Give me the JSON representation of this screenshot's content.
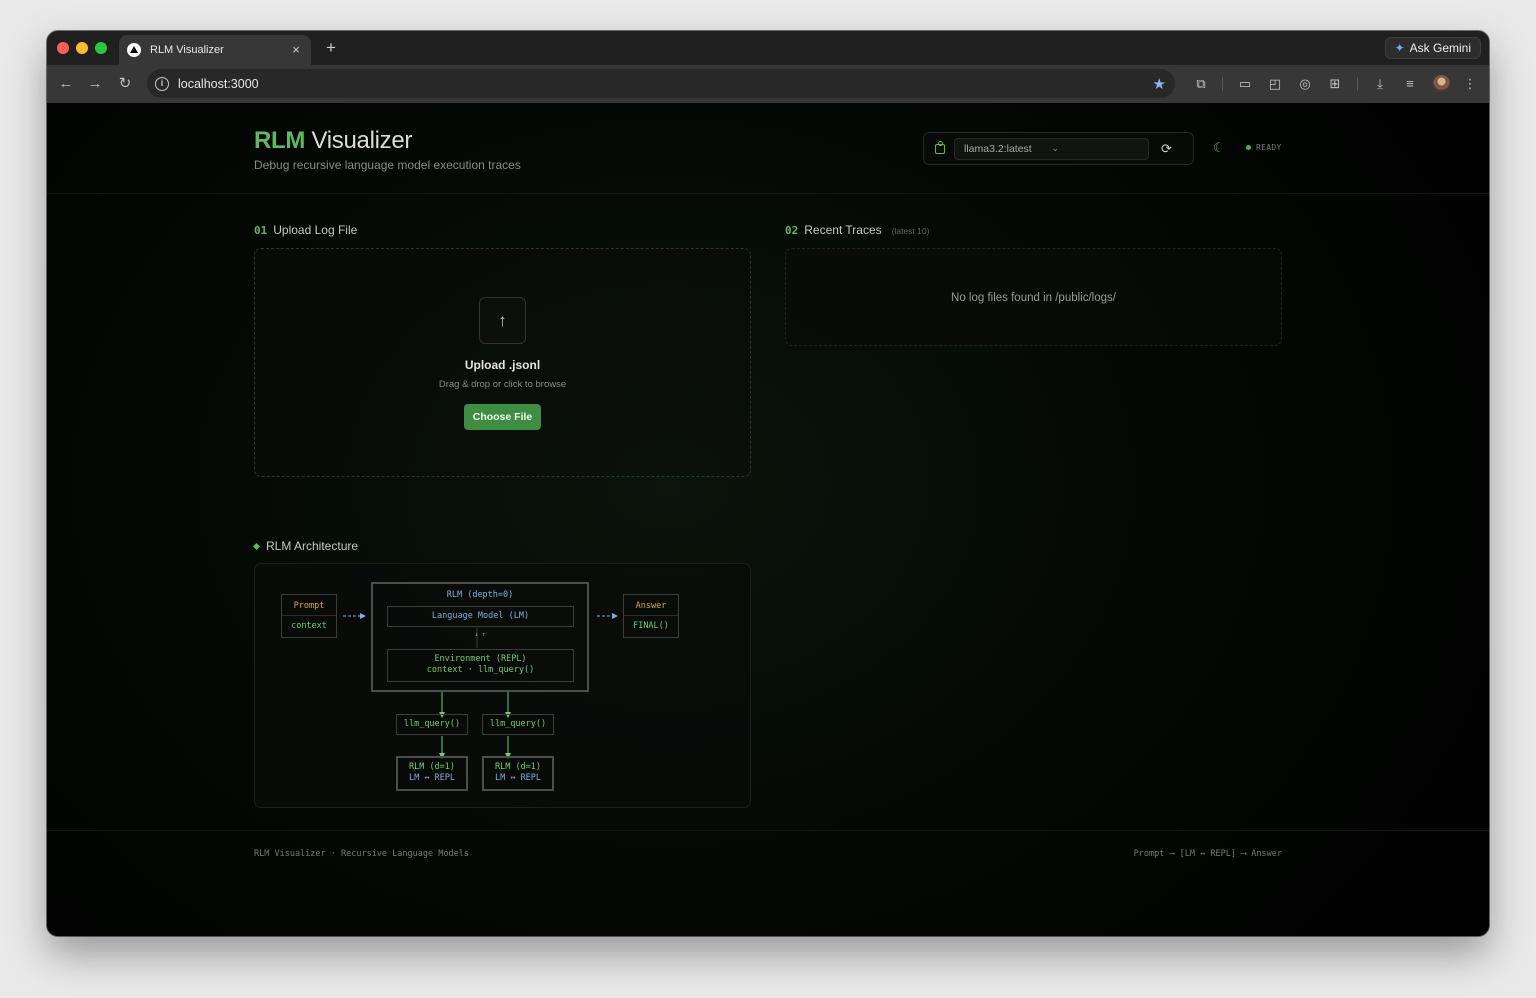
{
  "browser": {
    "tab_title": "RLM Visualizer",
    "url": "localhost:3000",
    "ask_gemini": "Ask Gemini",
    "new_tab": "+",
    "close_tab": "×"
  },
  "header": {
    "brand": "RLM",
    "title_rest": " Visualizer",
    "subtitle": "Debug recursive language model execution traces",
    "model_selected": "llama3.2:latest",
    "status": "READY"
  },
  "upload": {
    "section_num": "01",
    "section_title": "Upload Log File",
    "title": "Upload .jsonl",
    "subtitle": "Drag & drop or click to browse",
    "button_label": "Choose File",
    "icon": "upload-arrow-icon"
  },
  "traces": {
    "section_num": "02",
    "section_title": "Recent Traces",
    "note": "(latest 10)",
    "empty_text": "No log files found in /public/logs/"
  },
  "architecture": {
    "title": "RLM Architecture",
    "prompt_label": "Prompt",
    "prompt_sub": "context",
    "answer_label": "Answer",
    "answer_sub": "FINAL()",
    "rlm_label": "RLM (depth=0)",
    "lm_label": "Language Model (LM)",
    "io_arrows": "↓ ↑",
    "env_line1": "Environment (REPL)",
    "env_line2": "context · llm_query()",
    "query_label": "llm_query()",
    "child_line1": "RLM (d=1)",
    "child_line2": "LM ↔ REPL"
  },
  "footer": {
    "left": "RLM Visualizer · Recursive Language Models",
    "right": "Prompt ⟶ [LM ↔ REPL] ⟶ Answer"
  },
  "colors": {
    "accent": "#5fb95f",
    "button": "#3e8e41",
    "prompt_orange": "#d9a548",
    "lm_blue": "#7fb0e0"
  }
}
